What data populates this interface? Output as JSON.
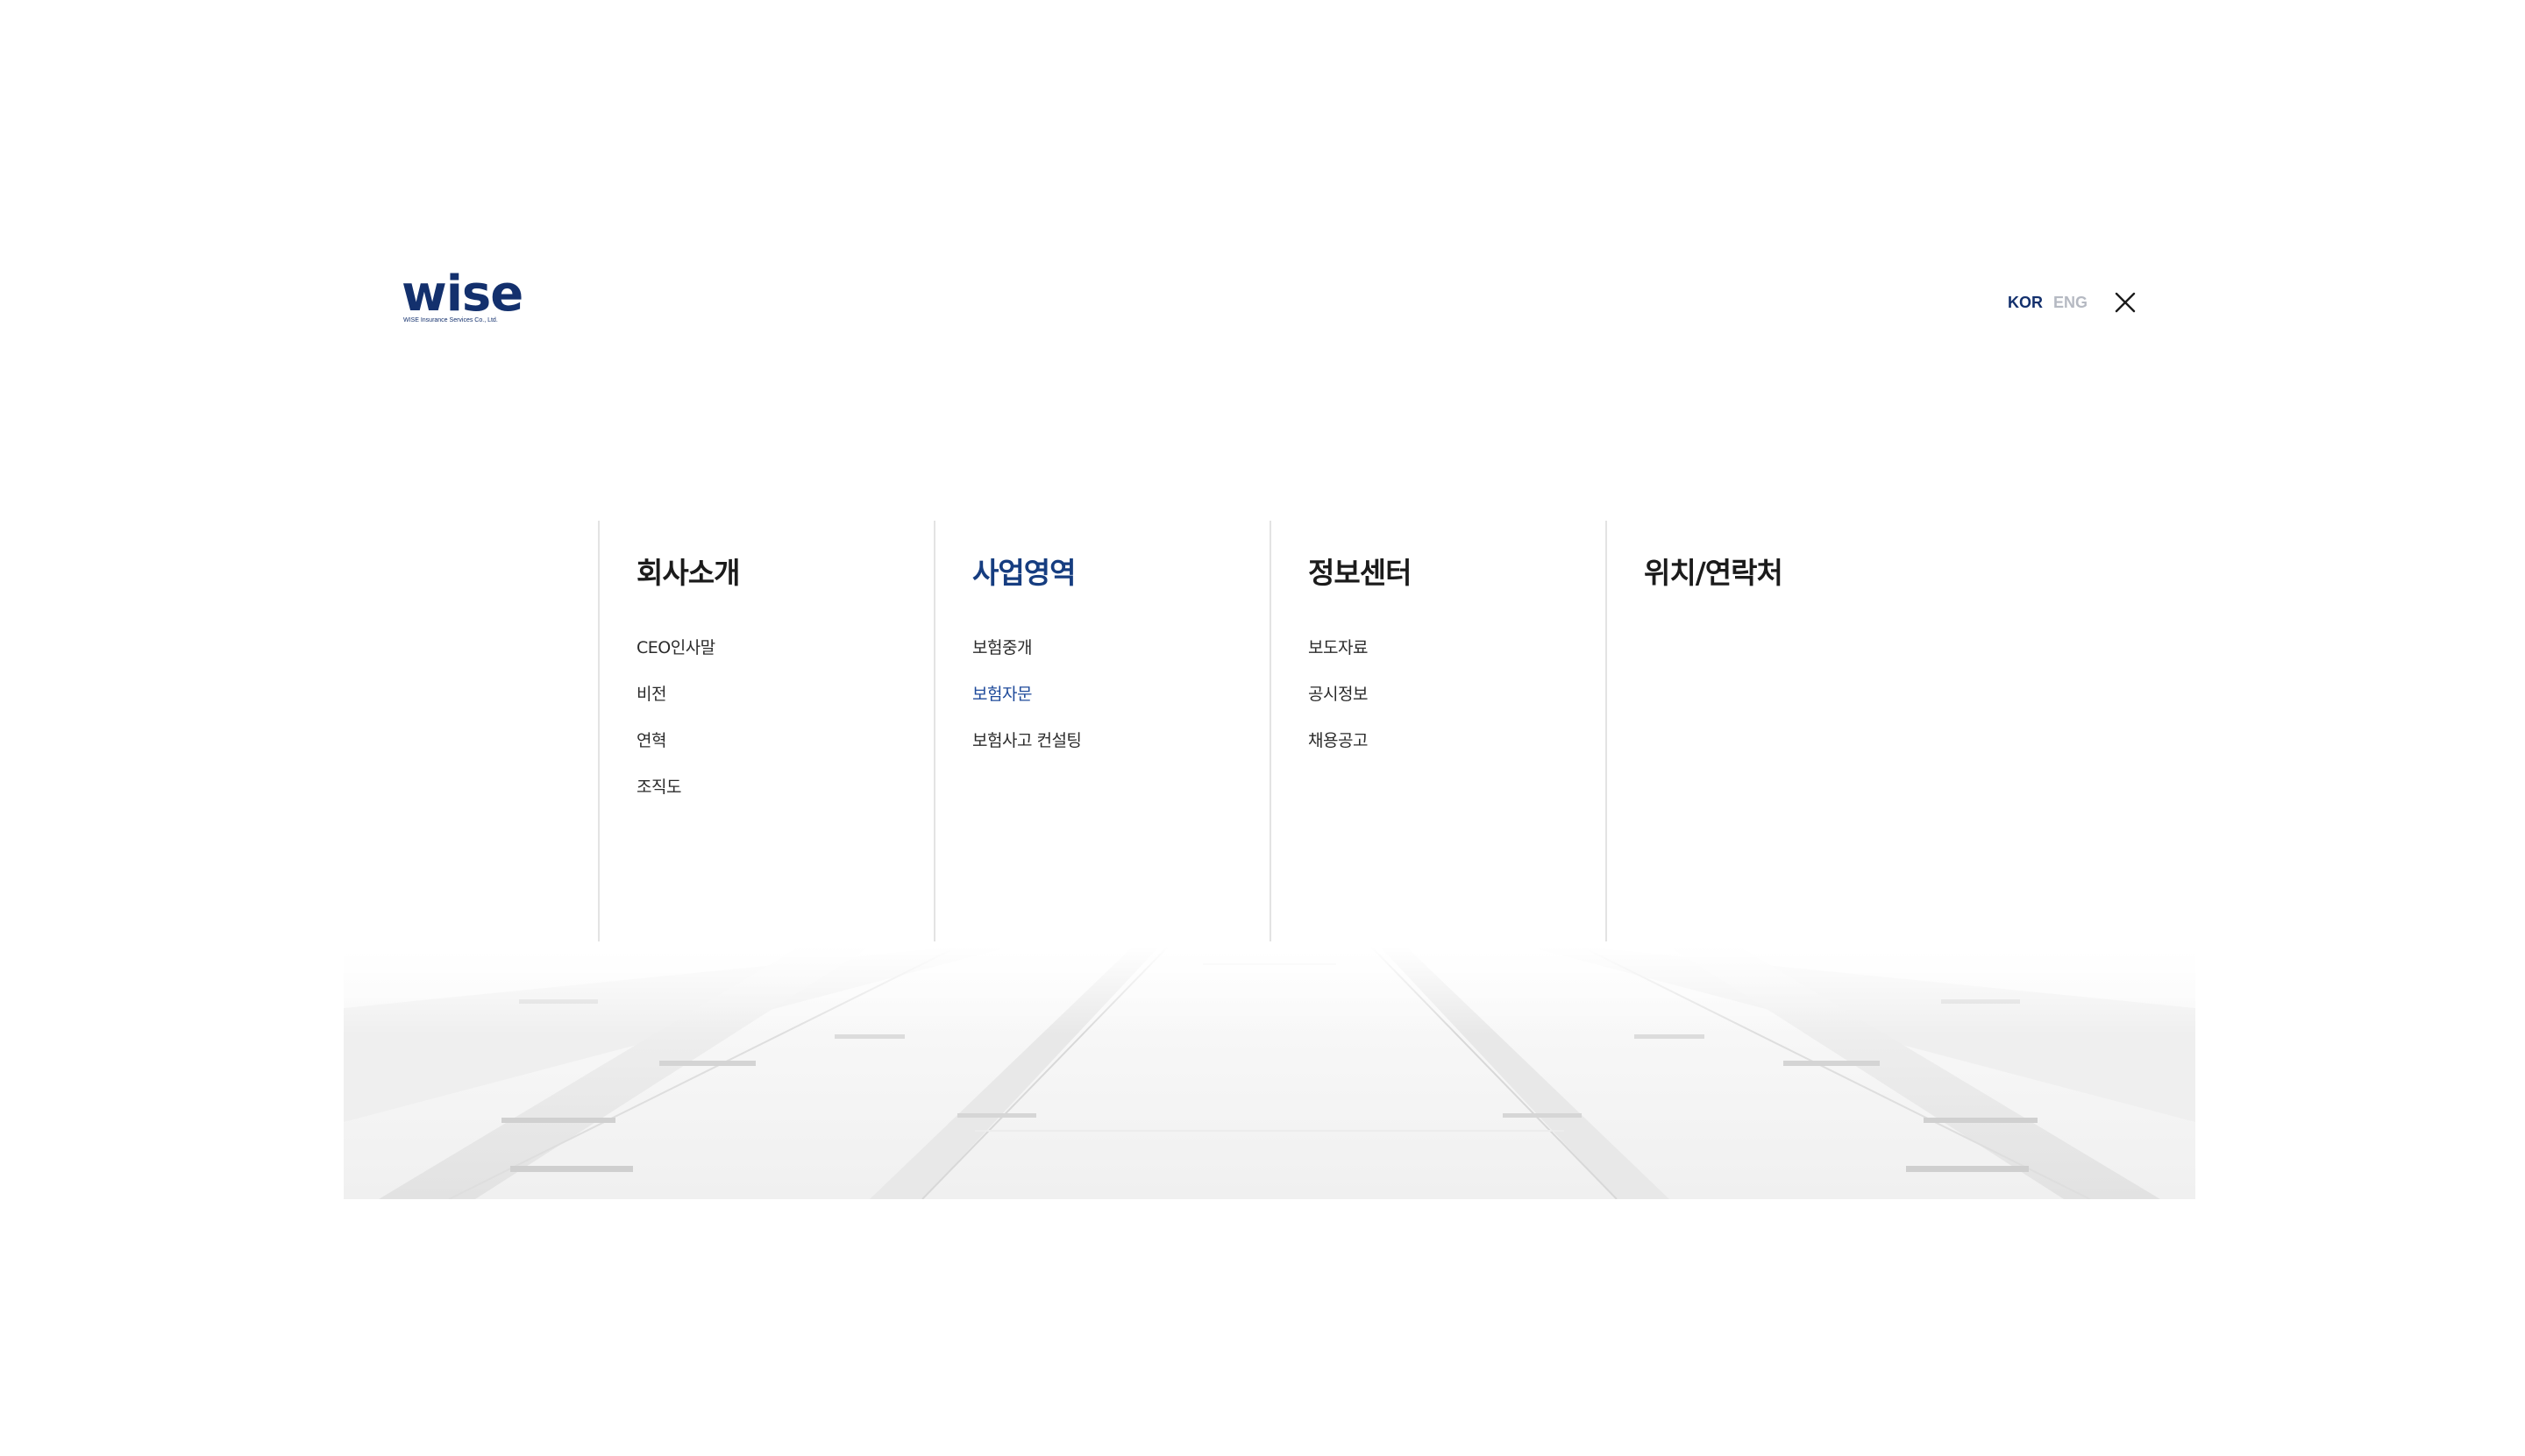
{
  "logo": {
    "word": "wise",
    "tagline": "WISE Insurance Services Co., Ltd."
  },
  "lang": {
    "kor": "KOR",
    "eng": "ENG",
    "active": "KOR"
  },
  "icons": {
    "close": "close-icon"
  },
  "colors": {
    "brand": "#13306d",
    "active_link": "#1e4a9a",
    "divider": "#e3e3e3",
    "muted": "#b5b9c2"
  },
  "menu": [
    {
      "title": "회사소개",
      "items": [
        "CEO인사말",
        "비전",
        "연혁",
        "조직도"
      ]
    },
    {
      "title": "사업영역",
      "active": true,
      "items": [
        "보험중개",
        "보험자문",
        "보험사고 컨설팅"
      ],
      "active_item": "보험자문"
    },
    {
      "title": "정보센터",
      "items": [
        "보도자료",
        "공시정보",
        "채용공고"
      ]
    },
    {
      "title": "위치/연락처",
      "items": []
    }
  ]
}
